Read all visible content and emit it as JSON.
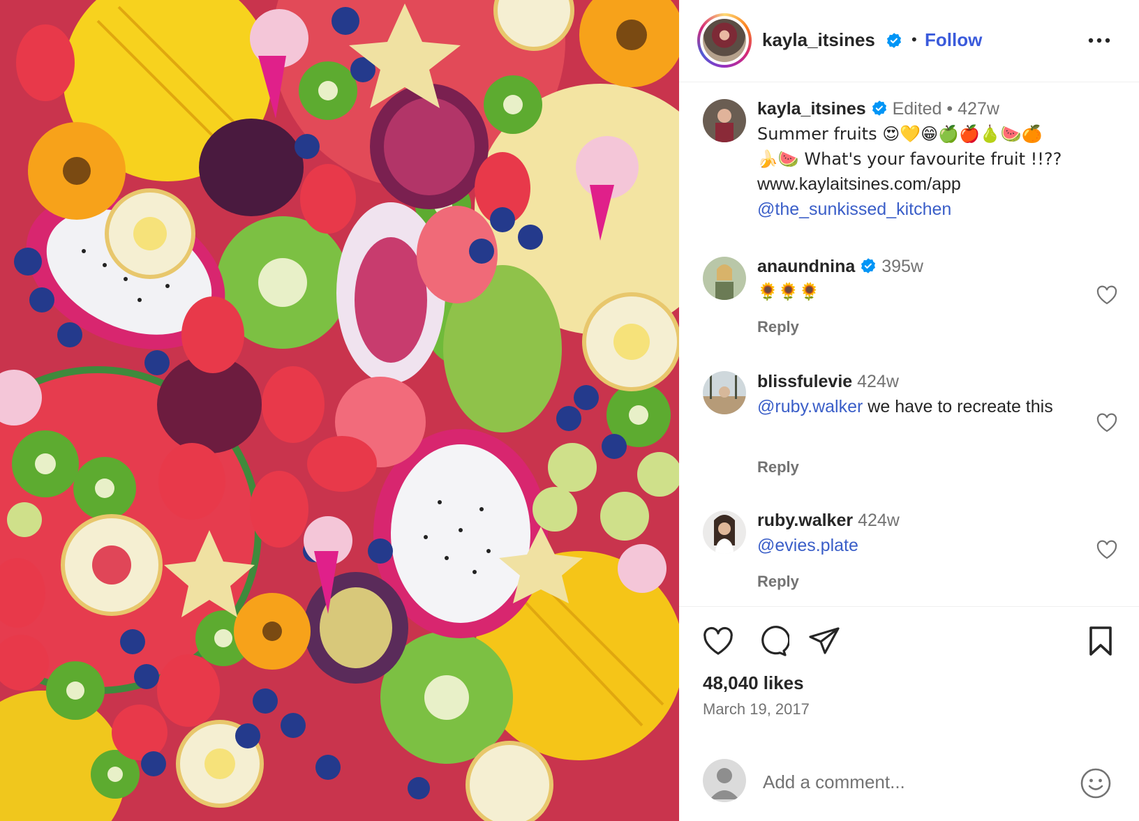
{
  "post": {
    "author": "kayla_itsines",
    "follow_label": "Follow",
    "separator": "•",
    "more_icon": "more-horizontal-icon"
  },
  "caption": {
    "username": "kayla_itsines",
    "edited": "Edited",
    "dot": "•",
    "age": "427w",
    "text_line1": "Summer fruits 😍💛😁🍏🍎🍐🍉🍊",
    "text_line2": "🍌🍉 What's your favourite fruit !!??",
    "text_line3": "www.kaylaitsines.com/app",
    "mention": "@the_sunkissed_kitchen"
  },
  "comments": [
    {
      "username": "anaundnina",
      "verified": true,
      "age": "395w",
      "text": "🌻🌻🌻",
      "reply_label": "Reply"
    },
    {
      "username": "blissfulevie",
      "verified": false,
      "age": "424w",
      "mention": "@ruby.walker",
      "text": " we have to recreate this",
      "reply_label": "Reply"
    },
    {
      "username": "ruby.walker",
      "verified": false,
      "age": "424w",
      "mention": "@evies.plate",
      "text": "",
      "reply_label": "Reply"
    }
  ],
  "stats": {
    "likes": "48,040 likes",
    "date": "March 19, 2017"
  },
  "composer": {
    "placeholder": "Add a comment..."
  },
  "colors": {
    "link": "#3a5ec8",
    "verified": "#0095f6",
    "muted": "#737373",
    "text": "#262626"
  }
}
